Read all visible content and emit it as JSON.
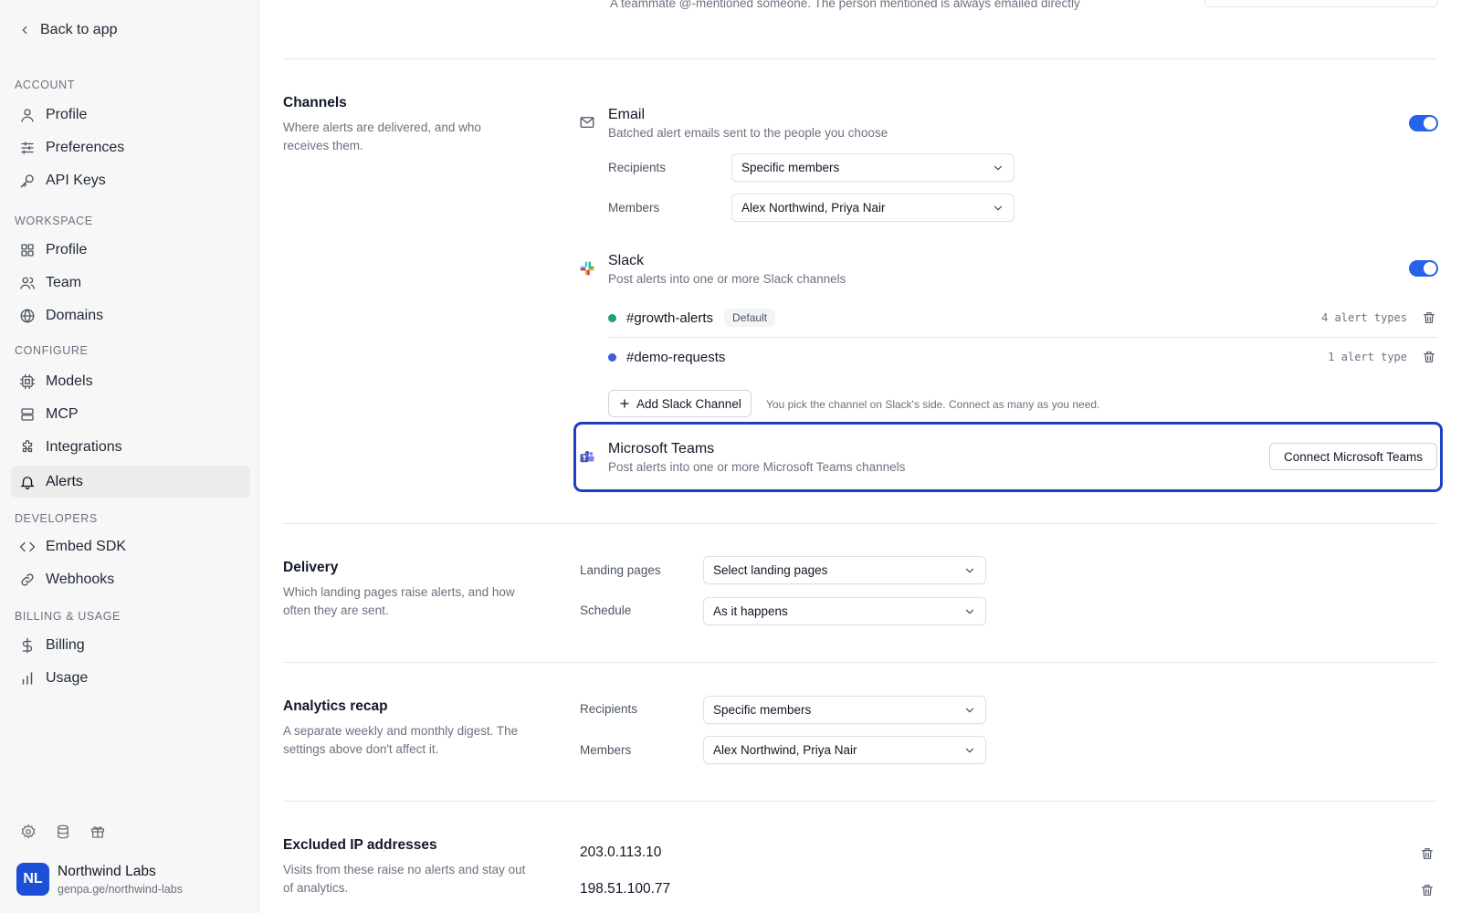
{
  "sidebar": {
    "back_label": "Back to app",
    "sections": {
      "account": "ACCOUNT",
      "workspace": "WORKSPACE",
      "configure": "CONFIGURE",
      "developers": "DEVELOPERS",
      "billing": "BILLING & USAGE"
    },
    "items": {
      "profile": "Profile",
      "preferences": "Preferences",
      "api_keys": "API Keys",
      "ws_profile": "Profile",
      "team": "Team",
      "domains": "Domains",
      "models": "Models",
      "mcp": "MCP",
      "integrations": "Integrations",
      "alerts": "Alerts",
      "embed_sdk": "Embed SDK",
      "webhooks": "Webhooks",
      "billing": "Billing",
      "usage": "Usage"
    },
    "active_item": "Alerts",
    "org": {
      "initials": "NL",
      "name": "Northwind Labs",
      "url": "genpa.ge/northwind-labs"
    }
  },
  "top_partial": {
    "description": "A teammate @-mentioned someone. The person mentioned is always emailed directly"
  },
  "channels": {
    "title": "Channels",
    "description": "Where alerts are delivered, and who receives them.",
    "email": {
      "name": "Email",
      "description": "Batched alert emails sent to the people you choose",
      "enabled": true,
      "recipients_label": "Recipients",
      "recipients_value": "Specific members",
      "members_label": "Members",
      "members_value": "Alex Northwind, Priya Nair"
    },
    "slack": {
      "name": "Slack",
      "description": "Post alerts into one or more Slack channels",
      "enabled": true,
      "rows": [
        {
          "channel": "#growth-alerts",
          "badge": "Default",
          "types": "4 alert types",
          "dot_color": "#22a06b"
        },
        {
          "channel": "#demo-requests",
          "types": "1 alert type",
          "dot_color": "#3b5bdb"
        }
      ],
      "add_label": "Add Slack Channel",
      "add_hint": "You pick the channel on Slack's side. Connect as many as you need."
    },
    "teams": {
      "name": "Microsoft Teams",
      "description": "Post alerts into one or more Microsoft Teams channels",
      "connect_label": "Connect Microsoft Teams",
      "highlight_color": "#1d3fc2"
    }
  },
  "delivery": {
    "title": "Delivery",
    "description": "Which landing pages raise alerts, and how often they are sent.",
    "landing_label": "Landing pages",
    "landing_value": "Select landing pages",
    "schedule_label": "Schedule",
    "schedule_value": "As it happens"
  },
  "recap": {
    "title": "Analytics recap",
    "description": "A separate weekly and monthly digest. The settings above don't affect it.",
    "recipients_label": "Recipients",
    "recipients_value": "Specific members",
    "members_label": "Members",
    "members_value": "Alex Northwind, Priya Nair"
  },
  "excluded_ips": {
    "title": "Excluded IP addresses",
    "description": "Visits from these raise no alerts and stay out of analytics.",
    "ips": [
      "203.0.113.10",
      "198.51.100.77"
    ]
  },
  "colors": {
    "accent": "#2563eb",
    "avatar": "#1d4ed8"
  }
}
